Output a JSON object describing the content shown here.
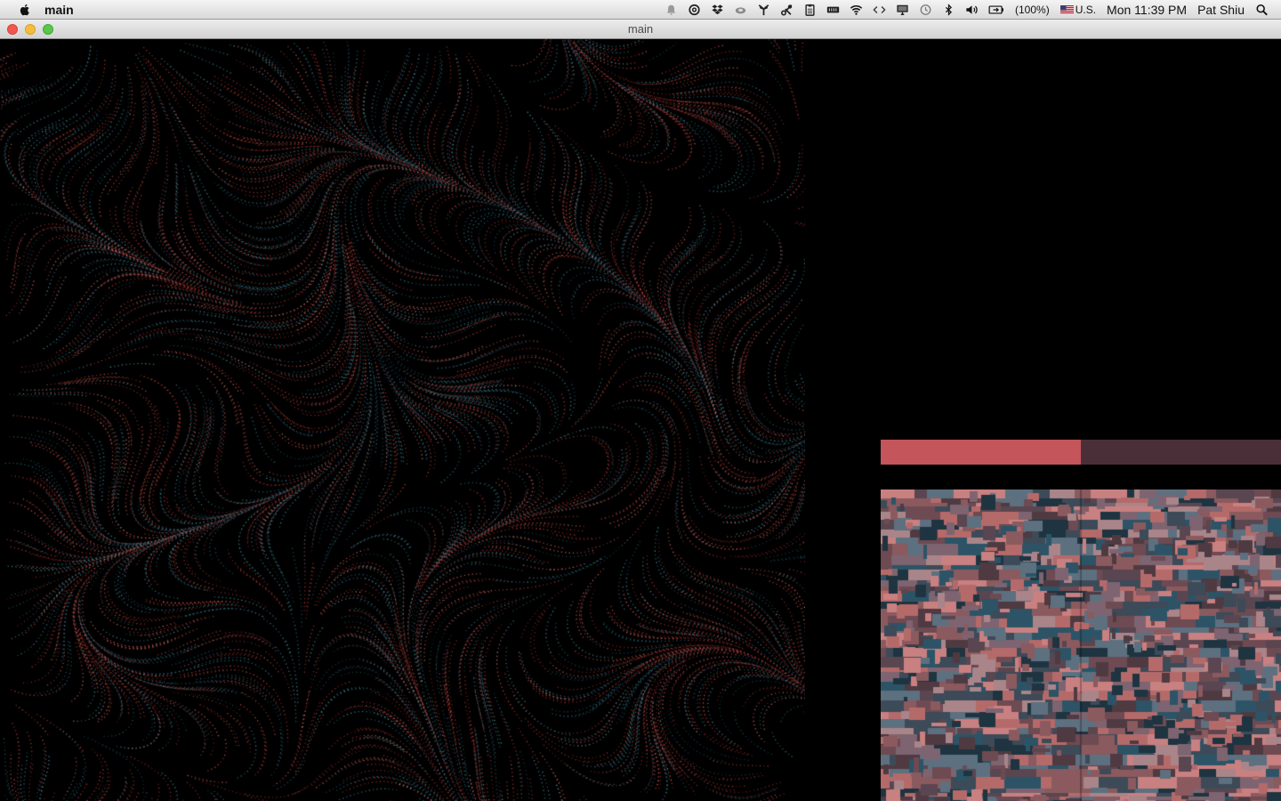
{
  "menubar": {
    "app_name": "main",
    "battery_text": "(100%)",
    "input_source": "U.S.",
    "clock": "Mon 11:39 PM",
    "user": "Pat Shiu",
    "icons": [
      "notification-icon",
      "circle-app-icon",
      "dropbox-icon",
      "cloud-icon",
      "antenna-icon",
      "scissors-icon",
      "clipboard-icon",
      "memory-icon",
      "wifi-icon",
      "code-icon",
      "display-icon",
      "time-machine-icon",
      "bluetooth-icon",
      "volume-icon",
      "battery-icon",
      "flag-icon",
      "spotlight-icon"
    ]
  },
  "window": {
    "title": "main"
  },
  "visualization": {
    "progress": 0.5,
    "colors": {
      "red": "#d9483f",
      "teal": "#2f6c80",
      "track": "#4a2f38",
      "fill": "#c4555a"
    }
  }
}
